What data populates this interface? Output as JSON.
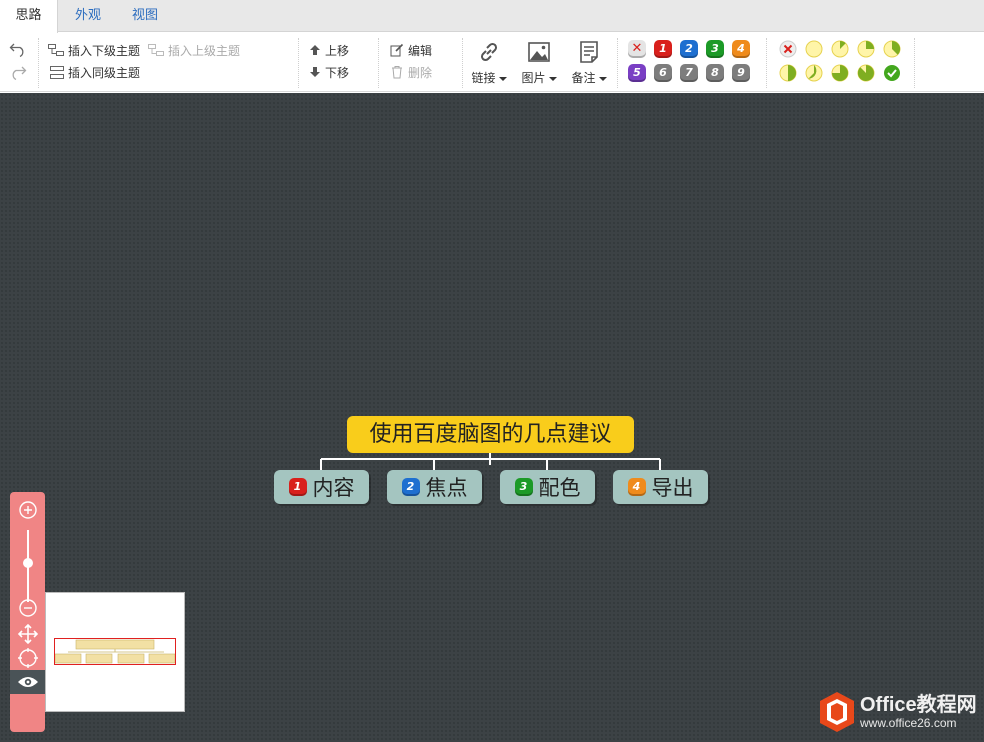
{
  "tabs": [
    {
      "label": "思路"
    },
    {
      "label": "外观"
    },
    {
      "label": "视图"
    }
  ],
  "toolbar": {
    "insert_child": "插入下级主题",
    "insert_parent": "插入上级主题",
    "insert_sibling": "插入同级主题",
    "move_up": "上移",
    "move_down": "下移",
    "edit": "编辑",
    "delete": "删除",
    "link": "链接",
    "image": "图片",
    "note": "备注"
  },
  "priorities": [
    "1",
    "2",
    "3",
    "4",
    "5",
    "6",
    "7",
    "8",
    "9"
  ],
  "colors": {
    "p1": "#d9201c",
    "p2": "#1e6fd0",
    "p3": "#1c9a27",
    "p4": "#ef8b1c",
    "p5": "#7a3fc4",
    "pgray": "#7d7d7d",
    "root": "#f9cd1b",
    "child": "#a4c5c0",
    "canvas": "#3c4245",
    "zoom_panel": "#f08585"
  },
  "mindmap": {
    "root": "使用百度脑图的几点建议",
    "children": [
      {
        "priority": "1",
        "label": "内容"
      },
      {
        "priority": "2",
        "label": "焦点"
      },
      {
        "priority": "3",
        "label": "配色"
      },
      {
        "priority": "4",
        "label": "导出"
      }
    ]
  },
  "watermark": {
    "line1": "Office教程网",
    "line2": "www.office26.com"
  }
}
